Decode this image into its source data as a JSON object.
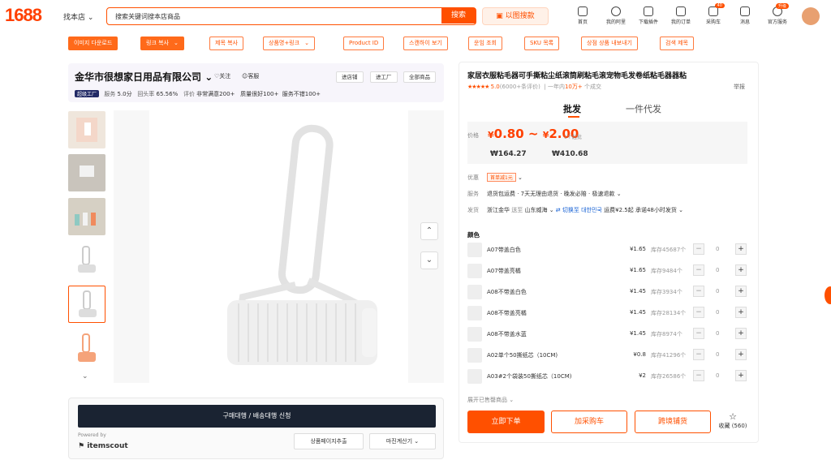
{
  "header": {
    "logo": "1688",
    "find_store": "找本店",
    "search_placeholder": "搜索关键词搜本店商品",
    "search_btn": "搜索",
    "image_search": "以图搜款",
    "nav": [
      {
        "label": "首页"
      },
      {
        "label": "我的阿里"
      },
      {
        "label": "下载插件"
      },
      {
        "label": "我的订单"
      },
      {
        "label": "采购车",
        "badge": "40"
      },
      {
        "label": "消息"
      },
      {
        "label": "官方服务",
        "badge": "升级"
      }
    ]
  },
  "toolbar": {
    "buttons": [
      "이미지 다운로드",
      "링크 복사",
      "제목 복사",
      "상품명+링크",
      "Product ID",
      "스캔하이 보기",
      "운임 조회",
      "SKU 목록",
      "상점 상품 내보내기",
      "검색 제목"
    ]
  },
  "shop": {
    "name": "金华市很想家日用品有限公司",
    "follow": "关注",
    "service": "客服",
    "btn_store": "进店铺",
    "btn_factory": "进工厂",
    "btn_all": "全部商品",
    "factory_badge": "超级工厂",
    "metrics": {
      "service_label": "服务",
      "service_value": "5.0分",
      "repurchase_label": "回头率",
      "repurchase_value": "65.56%",
      "review_label": "评价",
      "review_text": "非常满意200+",
      "quality_text": "质量很好100+",
      "service_text": "服务不错100+"
    }
  },
  "bottom": {
    "buy_agent": "구매대행 / 배송대행 신청",
    "powered": "Powered by",
    "itemscout": "itemscout",
    "page_extract": "상품페이지추출",
    "margin_calc": "마진계산기"
  },
  "product": {
    "title": "家居衣服粘毛器可手撕粘尘纸滚筒刷粘毛滚宠物毛发卷纸粘毛器器粘",
    "rating": "5.0",
    "reviews": "(6000+条评价)",
    "sales_prefix": "一年内",
    "sales": "10万+",
    "sales_suffix": "个成交",
    "report": "举报",
    "tab_wholesale": "批发",
    "tab_dropship": "一件代发",
    "price_label": "价格",
    "price_low": "0.80",
    "price_high": "2.00",
    "currency": "¥",
    "min_buy": "1个起批",
    "krw_low": "₩164.27",
    "krw_high": "₩410.68",
    "promo_label": "优惠",
    "coupon": "首单减1元",
    "service_label": "服务",
    "service_text": "退货包运费 · 7天无理由退货 · 晚发必赔 · 极速退款",
    "ship_label": "发货",
    "ship_from": "浙江金华",
    "ship_to_prefix": "送至",
    "ship_to": "山东威海",
    "switch_korea": "切换至 대한민국",
    "freight": "运费¥2.5起",
    "promise": "承诺48小时发货",
    "color_label": "颜色",
    "skus": [
      {
        "name": "A07带盖白色",
        "price": "¥1.65",
        "stock": "库存45687个",
        "qty": "0"
      },
      {
        "name": "A07带盖亮橘",
        "price": "¥1.65",
        "stock": "库存9484个",
        "qty": "0"
      },
      {
        "name": "A08不带盖白色",
        "price": "¥1.45",
        "stock": "库存3934个",
        "qty": "0"
      },
      {
        "name": "A08不带盖亮橘",
        "price": "¥1.45",
        "stock": "库存28134个",
        "qty": "0"
      },
      {
        "name": "A08不带盖水蓝",
        "price": "¥1.45",
        "stock": "库存8974个",
        "qty": "0"
      },
      {
        "name": "A02单个50撕纸芯（10CM)",
        "price": "¥0.8",
        "stock": "库存41296个",
        "qty": "0"
      },
      {
        "name": "A03#2个袋装50撕纸芯（10CM)",
        "price": "¥2",
        "stock": "库存26586个",
        "qty": "0"
      }
    ],
    "expand": "展开已售罄商品",
    "order_btn": "立即下单",
    "cart_btn": "加采购车",
    "cross_btn": "跨境铺货",
    "fav_label": "收藏",
    "fav_count": "(560)"
  },
  "colors": {
    "accent": "#ff5000",
    "dark_btn": "#1a2332"
  }
}
